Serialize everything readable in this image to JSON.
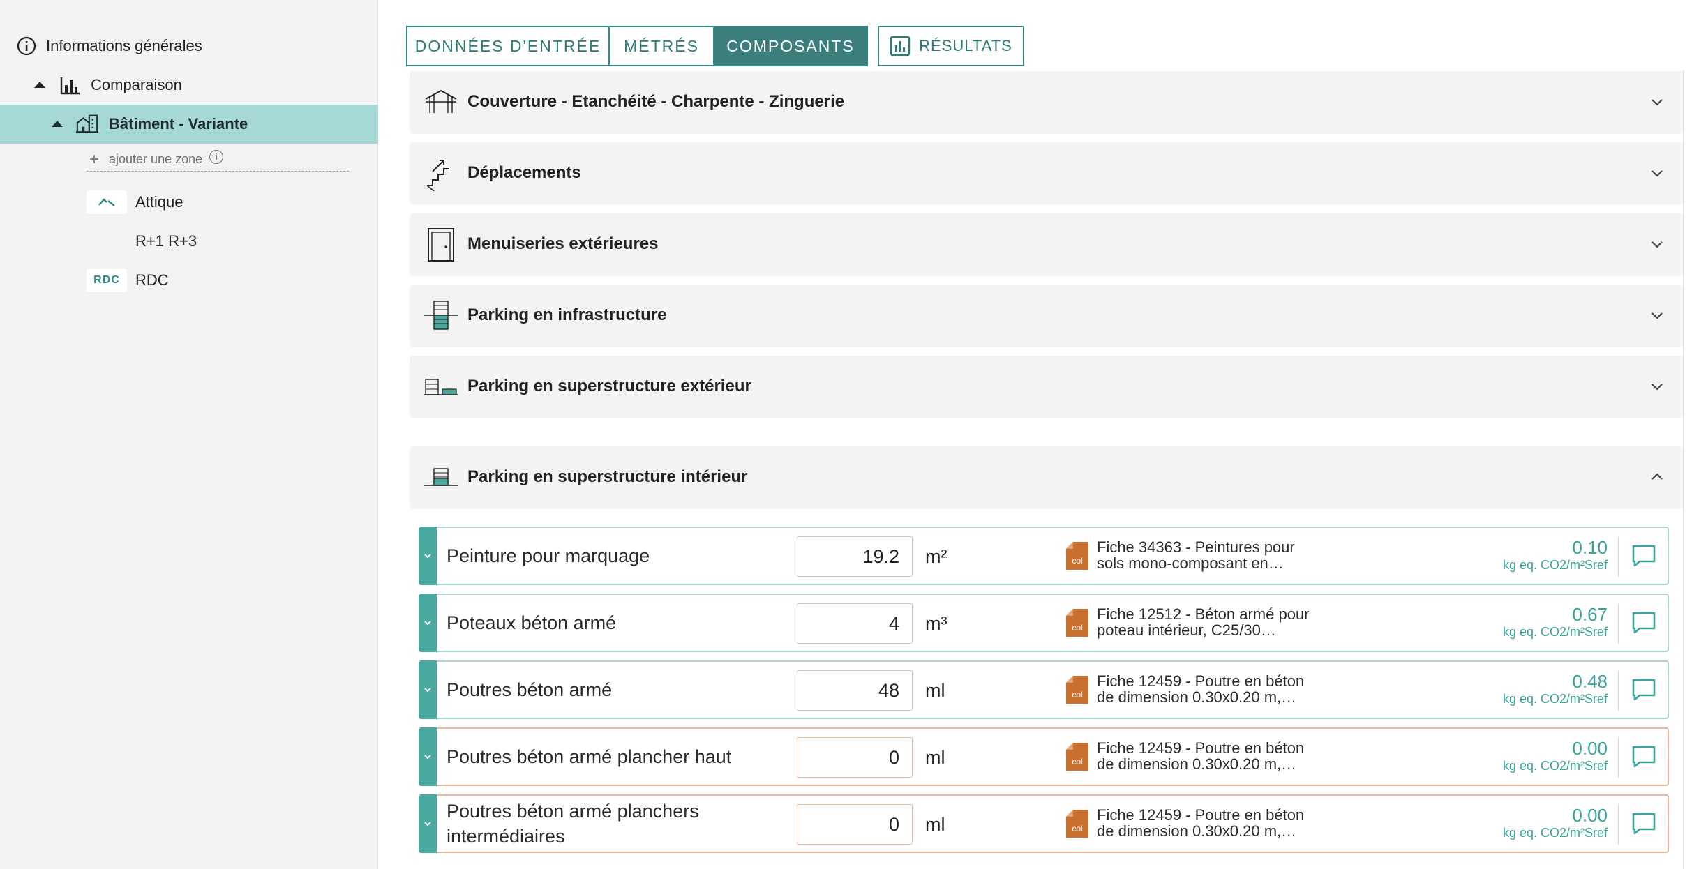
{
  "sidebar": {
    "general_info": "Informations générales",
    "comparison": "Comparaison",
    "building": "Bâtiment - Variante",
    "add_zone": "ajouter une zone",
    "zones": [
      {
        "badge": "",
        "label": "Attique"
      },
      {
        "badge": "",
        "label": "R+1 R+3"
      },
      {
        "badge": "RDC",
        "label": "RDC"
      }
    ]
  },
  "tabs": {
    "input": "DONNÉES D'ENTRÉE",
    "metres": "MÉTRÉS",
    "components": "COMPOSANTS",
    "results": "RÉSULTATS",
    "active": "COMPOSANTS"
  },
  "sections": [
    {
      "label": "Couverture - Etanchéité - Charpente - Zinguerie",
      "icon": "roof-icon",
      "expanded": false
    },
    {
      "label": "Déplacements",
      "icon": "stairs-icon",
      "expanded": false
    },
    {
      "label": "Menuiseries extérieures",
      "icon": "door-icon",
      "expanded": false
    },
    {
      "label": "Parking en infrastructure",
      "icon": "parking-infrastructure-icon",
      "expanded": false
    },
    {
      "label": "Parking en superstructure extérieur",
      "icon": "parking-exterior-icon",
      "expanded": false
    },
    {
      "label": "Parking en superstructure intérieur",
      "icon": "parking-interior-icon",
      "expanded": true
    }
  ],
  "components": [
    {
      "name": "Peinture pour marquage",
      "qty": "19.2",
      "unit": "m²",
      "fiche_line1": "Fiche 34363 - Peintures pour",
      "fiche_line2": "sols mono-composant en…",
      "value": "0.10",
      "value_unit": "kg eq. CO2/m²Sref"
    },
    {
      "name": "Poteaux béton armé",
      "qty": "4",
      "unit": "m³",
      "fiche_line1": "Fiche 12512 - Béton armé pour",
      "fiche_line2": "poteau intérieur, C25/30…",
      "value": "0.67",
      "value_unit": "kg eq. CO2/m²Sref"
    },
    {
      "name": "Poutres béton armé",
      "qty": "48",
      "unit": "ml",
      "fiche_line1": "Fiche 12459 - Poutre en béton",
      "fiche_line2": "de dimension 0.30x0.20 m,…",
      "value": "0.48",
      "value_unit": "kg eq. CO2/m²Sref"
    },
    {
      "name": "Poutres béton armé plancher haut",
      "qty": "0",
      "unit": "ml",
      "fiche_line1": "Fiche 12459 - Poutre en béton",
      "fiche_line2": "de dimension 0.30x0.20 m,…",
      "value": "0.00",
      "value_unit": "kg eq. CO2/m²Sref"
    },
    {
      "name_line1": "Poutres béton armé planchers",
      "name_line2": "intermédiaires",
      "qty": "0",
      "unit": "ml",
      "fiche_line1": "Fiche 12459 - Poutre en béton",
      "fiche_line2": "de dimension 0.30x0.20 m,…",
      "value": "0.00",
      "value_unit": "kg eq. CO2/m²Sref"
    }
  ],
  "fiche_badge": "col",
  "colors": {
    "accent": "#3a7d7b",
    "active_sidebar": "#a6d8d5",
    "value_text": "#3aa39a",
    "fiche_icon": "#c8702f",
    "zero_border": "#f0b79a",
    "row_border": "#a8d8d4"
  }
}
